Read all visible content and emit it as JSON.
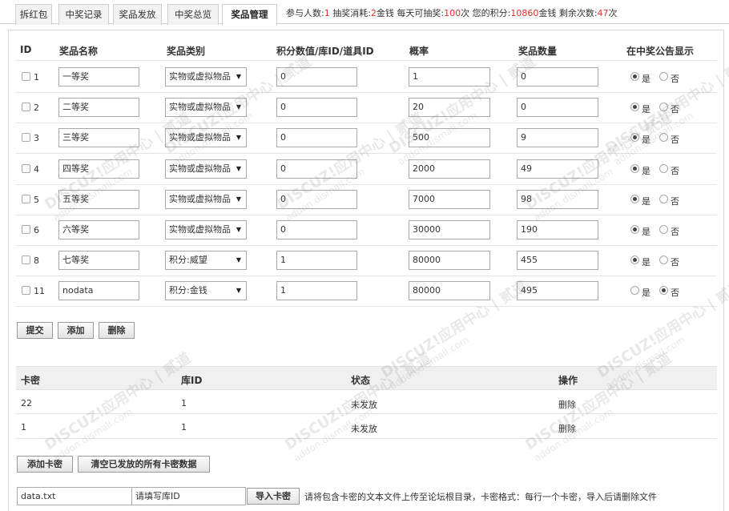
{
  "tabs": [
    {
      "label": "拆红包",
      "active": false
    },
    {
      "label": "中奖记录",
      "active": false
    },
    {
      "label": "奖品发放",
      "active": false
    },
    {
      "label": "中奖总览",
      "active": false
    },
    {
      "label": "奖品管理",
      "active": true
    }
  ],
  "stats": {
    "participants_label": "参与人数:",
    "participants": "1",
    "cost_label": " 抽奖消耗:",
    "cost": "2",
    "cost_unit": "金钱",
    "daily_label": " 每天可抽奖:",
    "daily": "100",
    "daily_unit": "次",
    "points_label": " 您的积分:",
    "points": "10860",
    "points_unit": "金钱",
    "remaining_label": " 剩余次数:",
    "remaining": "47",
    "remaining_unit": "次"
  },
  "prize_table": {
    "headers": [
      "ID",
      "奖品名称",
      "奖品类别",
      "积分数值/库ID/道具ID",
      "概率",
      "奖品数量",
      "在中奖公告显示"
    ],
    "yes_label": "是",
    "no_label": "否",
    "rows": [
      {
        "id": "1",
        "name": "一等奖",
        "category": "实物或虚拟物品",
        "value": "0",
        "probability": "1",
        "quantity": "0",
        "show": "yes"
      },
      {
        "id": "2",
        "name": "二等奖",
        "category": "实物或虚拟物品",
        "value": "0",
        "probability": "20",
        "quantity": "0",
        "show": "yes"
      },
      {
        "id": "3",
        "name": "三等奖",
        "category": "实物或虚拟物品",
        "value": "0",
        "probability": "500",
        "quantity": "9",
        "show": "yes"
      },
      {
        "id": "4",
        "name": "四等奖",
        "category": "实物或虚拟物品",
        "value": "0",
        "probability": "2000",
        "quantity": "49",
        "show": "yes"
      },
      {
        "id": "5",
        "name": "五等奖",
        "category": "实物或虚拟物品",
        "value": "0",
        "probability": "7000",
        "quantity": "98",
        "show": "yes"
      },
      {
        "id": "6",
        "name": "六等奖",
        "category": "实物或虚拟物品",
        "value": "0",
        "probability": "30000",
        "quantity": "190",
        "show": "yes"
      },
      {
        "id": "8",
        "name": "七等奖",
        "category": "积分:威望",
        "value": "1",
        "probability": "80000",
        "quantity": "455",
        "show": "yes"
      },
      {
        "id": "11",
        "name": "nodata",
        "category": "积分:金钱",
        "value": "1",
        "probability": "80000",
        "quantity": "495",
        "show": "no"
      }
    ]
  },
  "actions": {
    "submit": "提交",
    "add": "添加",
    "delete": "删除"
  },
  "card_table": {
    "headers": [
      "卡密",
      "库ID",
      "状态",
      "操作"
    ],
    "rows": [
      {
        "card": "22",
        "lib_id": "1",
        "status": "未发放",
        "action": "删除"
      },
      {
        "card": "1",
        "lib_id": "1",
        "status": "未发放",
        "action": "删除"
      }
    ]
  },
  "card_actions": {
    "add_card": "添加卡密",
    "clear_issued": "清空已发放的所有卡密数据"
  },
  "import": {
    "file_value": "data.txt",
    "lib_placeholder": "请填写库ID",
    "import_button": "导入卡密",
    "hint": "请将包含卡密的文本文件上传至论坛根目录，卡密格式：每行一个卡密，导入后请删除文件"
  },
  "watermark": {
    "brand": "DISCUZ!应用中心 | 贰道",
    "url": "addon.dismall.com"
  }
}
